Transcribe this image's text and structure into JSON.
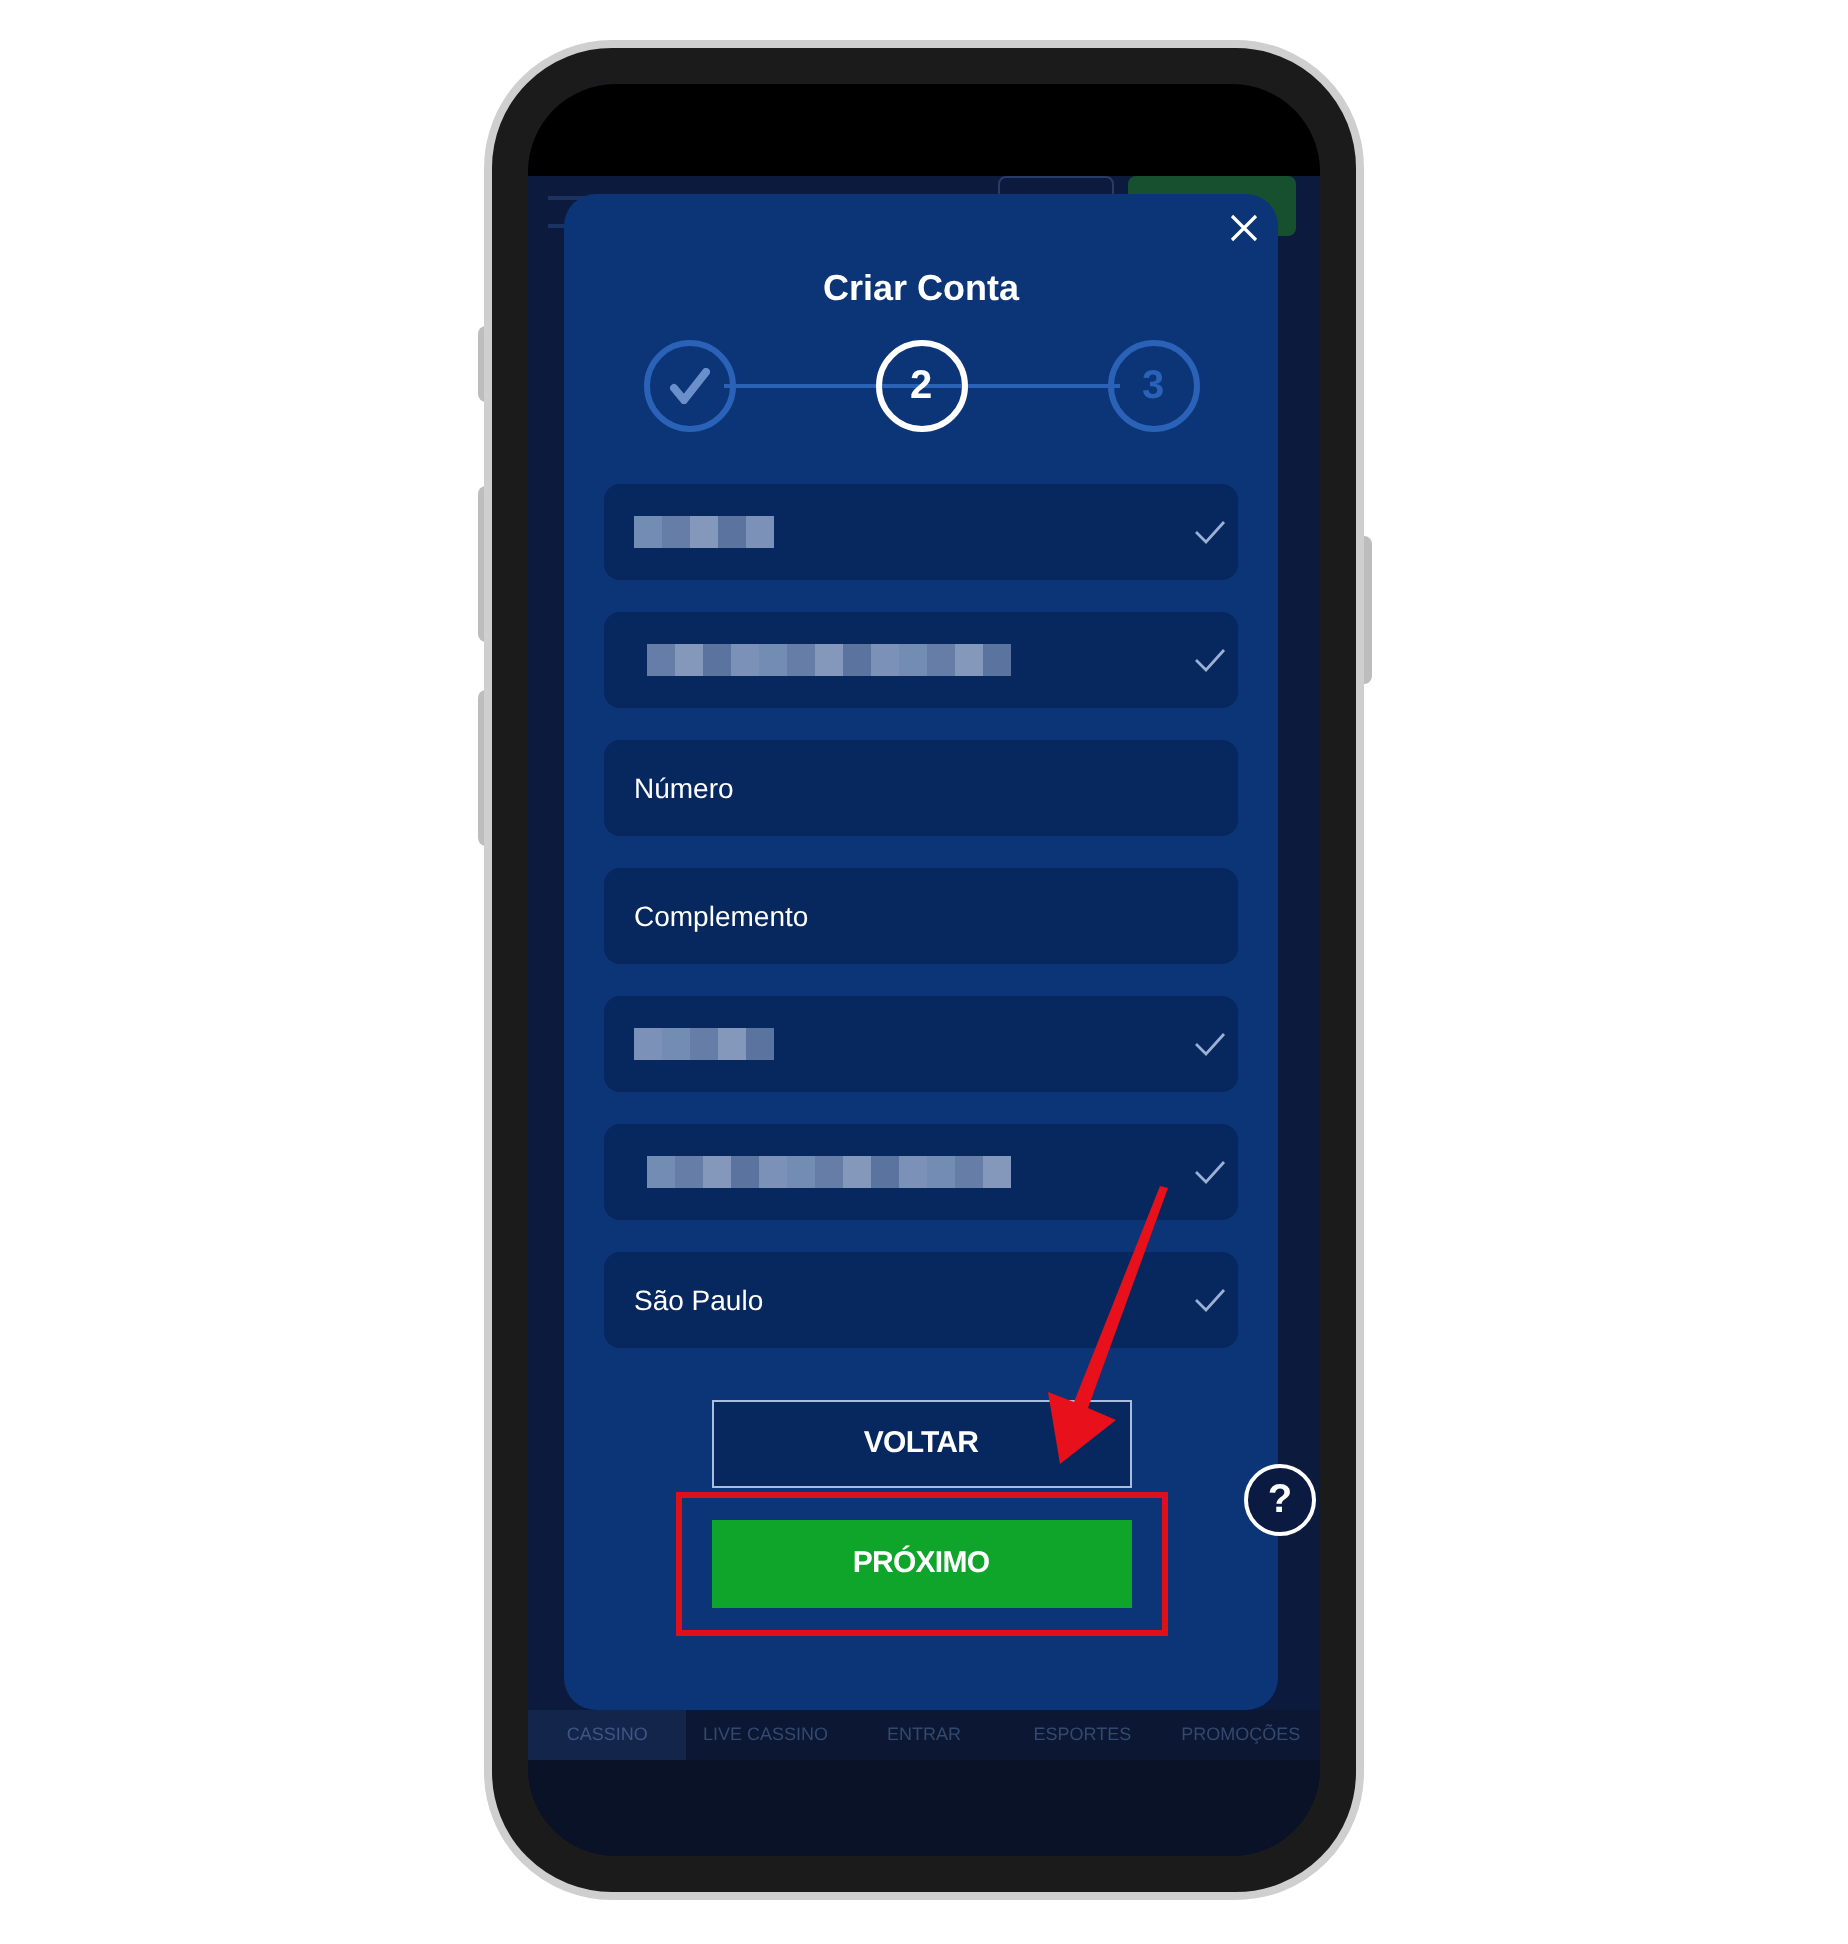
{
  "modal": {
    "title": "Criar Conta",
    "steps": [
      {
        "kind": "done"
      },
      {
        "label": "2",
        "kind": "current"
      },
      {
        "label": "3",
        "kind": "upcoming"
      }
    ],
    "fields": [
      {
        "kind": "redacted",
        "checked": true
      },
      {
        "kind": "redacted",
        "checked": true
      },
      {
        "kind": "text",
        "label": "Número",
        "checked": false
      },
      {
        "kind": "text",
        "label": "Complemento",
        "checked": false
      },
      {
        "kind": "redacted",
        "checked": true
      },
      {
        "kind": "redacted",
        "checked": true
      },
      {
        "kind": "text",
        "label": "São Paulo",
        "checked": true
      }
    ],
    "buttons": [
      {
        "label": "VOLTAR",
        "kind": "outline",
        "highlighted": false
      },
      {
        "label": "PRÓXIMO",
        "kind": "primary",
        "highlighted": true
      }
    ]
  },
  "help_button": {
    "label": "?"
  },
  "bottom_nav": [
    {
      "label": "CASSINO",
      "selected": true
    },
    {
      "label": "LIVE CASSINO",
      "selected": false
    },
    {
      "label": "ENTRAR",
      "selected": false
    },
    {
      "label": "ESPORTES",
      "selected": false
    },
    {
      "label": "PROMOÇÕES",
      "selected": false
    }
  ]
}
